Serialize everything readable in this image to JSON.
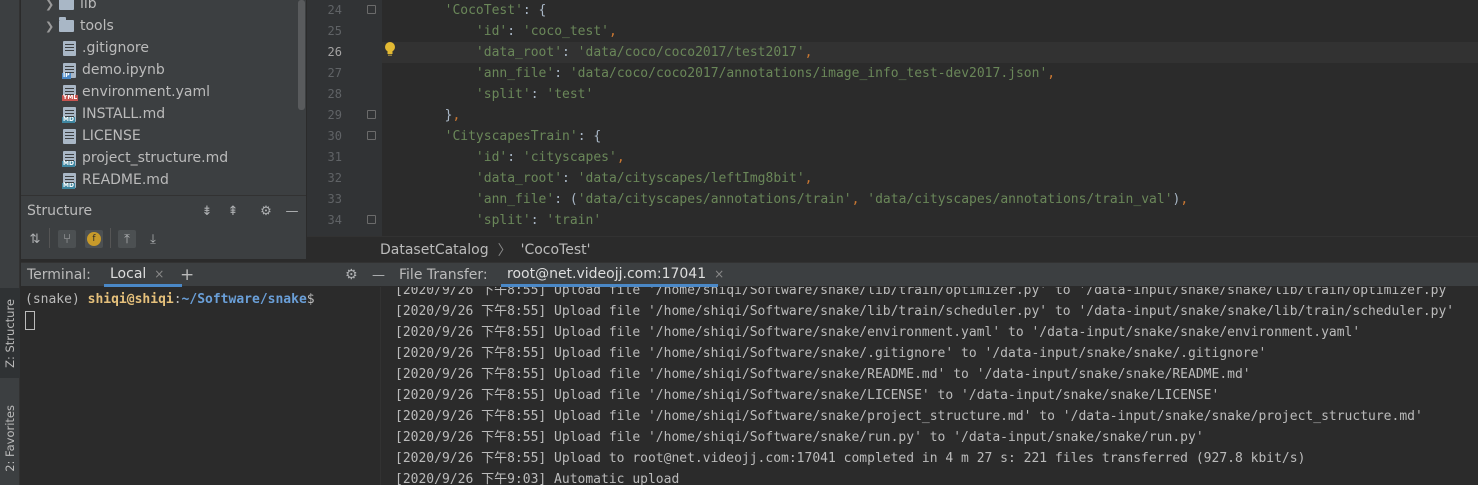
{
  "strip": {
    "structure_tab": "Z: Structure",
    "favorites_tab": "2: Favorites"
  },
  "tree": {
    "items": [
      {
        "label": "lib",
        "type": "folder"
      },
      {
        "label": "tools",
        "type": "folder"
      },
      {
        "label": ".gitignore",
        "type": "file"
      },
      {
        "label": "demo.ipynb",
        "type": "file",
        "tag": "IP"
      },
      {
        "label": "environment.yaml",
        "type": "file",
        "tag": "YML"
      },
      {
        "label": "INSTALL.md",
        "type": "file",
        "tag": "MD"
      },
      {
        "label": "LICENSE",
        "type": "file"
      },
      {
        "label": "project_structure.md",
        "type": "file",
        "tag": "MD"
      },
      {
        "label": "README.md",
        "type": "file",
        "tag": "MD"
      }
    ]
  },
  "structure": {
    "title": "Structure"
  },
  "editor": {
    "line_numbers": [
      "24",
      "25",
      "26",
      "27",
      "28",
      "29",
      "30",
      "31",
      "32",
      "33",
      "34"
    ],
    "current_line": "26"
  },
  "breadcrumb": {
    "items": [
      "DatasetCatalog",
      "'CocoTest'"
    ]
  },
  "terminal": {
    "title": "Terminal:",
    "tab": "Local",
    "close": "×",
    "add": "+",
    "prompt_env": "(snake)",
    "prompt_user": "shiqi@shiqi",
    "prompt_sep": ":",
    "prompt_path": "~/Software/snake",
    "prompt_end": "$"
  },
  "file_transfer": {
    "title": "File Transfer:",
    "tab": "root@net.videojj.com:17041",
    "close": "×",
    "log": [
      "[2020/9/26 下午8:55] Upload file '/home/shiqi/Software/snake/lib/train/optimizer.py' to '/data-input/snake/snake/lib/train/optimizer.py",
      "[2020/9/26 下午8:55] Upload file '/home/shiqi/Software/snake/lib/train/scheduler.py' to '/data-input/snake/snake/lib/train/scheduler.py'",
      "[2020/9/26 下午8:55] Upload file '/home/shiqi/Software/snake/environment.yaml' to '/data-input/snake/snake/environment.yaml'",
      "[2020/9/26 下午8:55] Upload file '/home/shiqi/Software/snake/.gitignore' to '/data-input/snake/snake/.gitignore'",
      "[2020/9/26 下午8:55] Upload file '/home/shiqi/Software/snake/README.md' to '/data-input/snake/snake/README.md'",
      "[2020/9/26 下午8:55] Upload file '/home/shiqi/Software/snake/LICENSE' to '/data-input/snake/snake/LICENSE'",
      "[2020/9/26 下午8:55] Upload file '/home/shiqi/Software/snake/project_structure.md' to '/data-input/snake/snake/project_structure.md'",
      "[2020/9/26 下午8:55] Upload file '/home/shiqi/Software/snake/run.py' to '/data-input/snake/snake/run.py'",
      "[2020/9/26 下午8:55] Upload to root@net.videojj.com:17041 completed in 4 m 27 s: 221 files transferred (927.8 kbit/s)",
      "[2020/9/26 下午9:03] Automatic upload"
    ]
  },
  "colors": {
    "string": "#6a8759",
    "punct": "#cc7832",
    "text": "#a9b7c6",
    "prompt_user": "#e5c07b",
    "prompt_path": "#6a9fd8",
    "tab_underline": "#4a88c7"
  }
}
